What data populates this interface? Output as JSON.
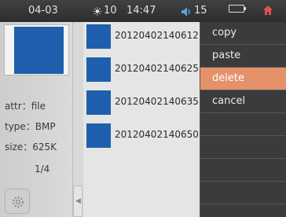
{
  "status": {
    "date": "04-03",
    "sun_icon": "sun-icon",
    "brightness": "10",
    "time": "14:47",
    "volume_icon": "speaker-icon",
    "volume": "15",
    "battery_icon": "battery-icon",
    "home_icon": "home-icon"
  },
  "preview": {
    "attr": "attr：file",
    "type": "type：BMP",
    "size": "size：625K",
    "page": "1/4",
    "thumb_color": "#1f5fae"
  },
  "files": [
    {
      "name": "20120402140612"
    },
    {
      "name": "20120402140625"
    },
    {
      "name": "20120402140635"
    },
    {
      "name": "20120402140650"
    }
  ],
  "menu": {
    "items": [
      {
        "label": "copy"
      },
      {
        "label": "paste"
      },
      {
        "label": "delete",
        "active": true
      },
      {
        "label": "cancel"
      },
      {
        "label": ""
      },
      {
        "label": ""
      },
      {
        "label": ""
      },
      {
        "label": ""
      }
    ],
    "active_color": "#e5916a"
  }
}
